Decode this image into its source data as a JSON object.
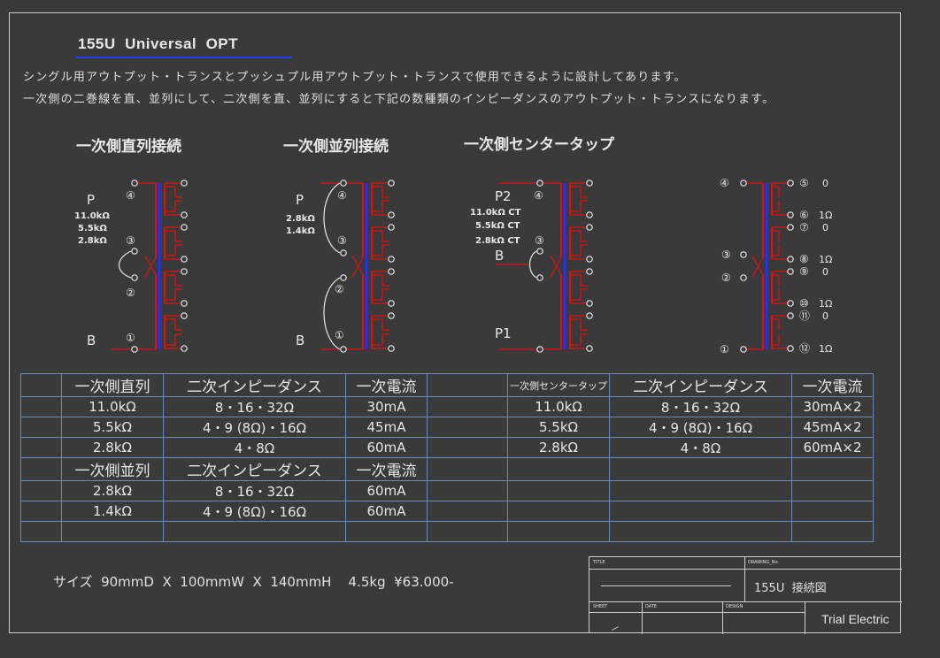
{
  "title": "155U  Universal  OPT",
  "description": [
    "シングル用アウトプット・トランスとプッシュプル用アウトプット・トランスで使用できるように設計してあります。",
    "一次側の二巻線を直、並列にして、二次側を直、並列にすると下記の数種類のインピーダンスのアウトプット・トランスになります。"
  ],
  "sections": {
    "series": "一次側直列接続",
    "parallel": "一次側並列接続",
    "center_tap": "一次側センタータップ"
  },
  "diagram_labels": {
    "series": {
      "p": "P",
      "b": "B",
      "imps": [
        "11.0kΩ",
        "5.5kΩ",
        "2.8kΩ"
      ],
      "pins": [
        "④",
        "③",
        "②",
        "①"
      ]
    },
    "parallel": {
      "p": "P",
      "b": "B",
      "imps": [
        "2.8kΩ",
        "1.4kΩ"
      ],
      "pins": [
        "④",
        "③",
        "②",
        "①"
      ]
    },
    "center_tap": {
      "p2": "P2",
      "b": "B",
      "p1": "P1",
      "imps": [
        "11.0kΩ  CT",
        "5.5kΩ  CT",
        "2.8kΩ  CT"
      ],
      "pins": [
        "④",
        "③"
      ]
    },
    "pinout": {
      "left_pins": [
        "④",
        "③",
        "②",
        "①"
      ],
      "right_pins": [
        {
          "pin": "⑤",
          "val": "0"
        },
        {
          "pin": "⑥",
          "val": "1Ω"
        },
        {
          "pin": "⑦",
          "val": "0"
        },
        {
          "pin": "⑧",
          "val": "1Ω"
        },
        {
          "pin": "⑨",
          "val": "0"
        },
        {
          "pin": "⑩",
          "val": "1Ω"
        },
        {
          "pin": "⑪",
          "val": "0"
        },
        {
          "pin": "⑫",
          "val": "1Ω"
        }
      ]
    }
  },
  "table": {
    "series": {
      "headers": [
        "一次側直列",
        "二次インピーダンス",
        "一次電流"
      ],
      "rows": [
        [
          "11.0kΩ",
          "8・16・32Ω",
          "30mA"
        ],
        [
          "5.5kΩ",
          "4・9 (8Ω)・16Ω",
          "45mA"
        ],
        [
          "2.8kΩ",
          "4・8Ω",
          "60mA"
        ]
      ]
    },
    "parallel": {
      "headers": [
        "一次側並列",
        "二次インピーダンス",
        "一次電流"
      ],
      "rows": [
        [
          "2.8kΩ",
          "8・16・32Ω",
          "60mA"
        ],
        [
          "1.4kΩ",
          "4・9 (8Ω)・16Ω",
          "60mA"
        ]
      ]
    },
    "center_tap": {
      "headers": [
        "一次側センタータップ",
        "二次インピーダンス",
        "一次電流"
      ],
      "rows": [
        [
          "11.0kΩ",
          "8・16・32Ω",
          "30mA×2"
        ],
        [
          "5.5kΩ",
          "4・9 (8Ω)・16Ω",
          "45mA×2"
        ],
        [
          "2.8kΩ",
          "4・8Ω",
          "60mA×2"
        ]
      ]
    }
  },
  "size_line": "サイズ  90mmD  X  100mmW  X  140mmH    4.5kg  ¥63.000-",
  "title_block": {
    "title_label": "TITLE",
    "drawing_no_label": "DRAWING_No.",
    "drawing_no": "155U  接続図",
    "sheet_label": "SHEET",
    "date_label": "DATE",
    "design_label": "DESIGN",
    "company": "Trial Electric"
  },
  "colors": {
    "background": "#3a3a3a",
    "winding": "#e01010",
    "core_blue": "#2030ff",
    "table_border": "#6f86b8",
    "title_underline": "#1f3cff"
  }
}
